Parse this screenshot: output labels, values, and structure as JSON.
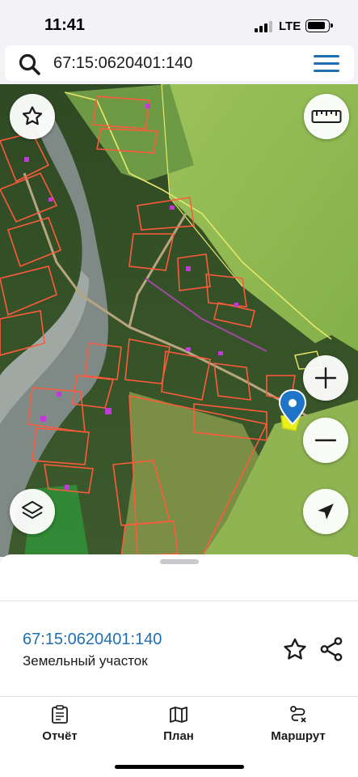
{
  "status_bar": {
    "time": "11:41",
    "network": "LTE"
  },
  "search": {
    "query": "67:15:0620401:140",
    "icon": "search-icon",
    "menu_icon": "hamburger-menu-icon"
  },
  "map_controls": {
    "favorite": "star-icon",
    "ruler": "ruler-icon",
    "zoom_in": "plus-icon",
    "zoom_out": "minus-icon",
    "layers": "layers-icon",
    "locate": "navigation-arrow-icon",
    "marker": "location-pin-icon"
  },
  "sheet": {
    "cadastral_number": "67:15:0620401:140",
    "object_type": "Земельный участок",
    "actions": [
      "star-icon",
      "share-icon"
    ]
  },
  "tabs": [
    {
      "label": "Отчёт",
      "icon": "report-clipboard-icon"
    },
    {
      "label": "План",
      "icon": "map-plan-icon"
    },
    {
      "label": "Маршрут",
      "icon": "route-icon"
    }
  ],
  "colors": {
    "accent": "#1f6fb5",
    "parcel_outline": "#ff5a3c",
    "selected_parcel": "#e8f21a",
    "zone_outline": "#e6e86a"
  }
}
